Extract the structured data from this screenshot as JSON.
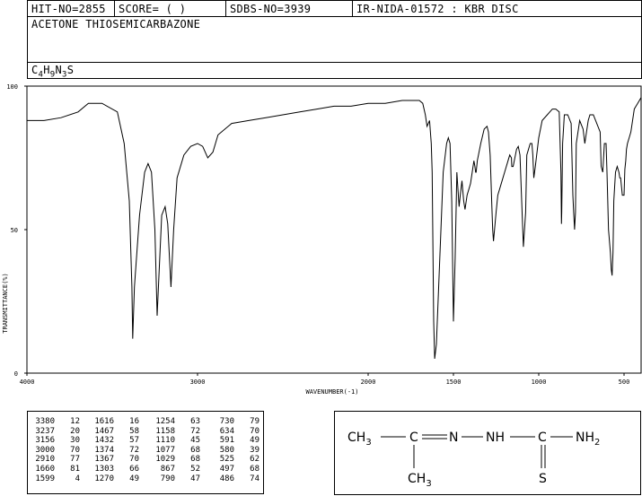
{
  "header": {
    "hit_no": "HIT-NO=2855",
    "score": "SCORE=  (   )",
    "sdbs_no": "SDBS-NO=3939",
    "ir_nida": "IR-NIDA-01572 : KBR DISC"
  },
  "compound": {
    "name": "ACETONE THIOSEMICARBAZONE",
    "formula_parts": [
      "C",
      "4",
      "H",
      "9",
      "N",
      "3",
      "S"
    ]
  },
  "chart_data": {
    "type": "line",
    "xlabel": "WAVENUMBER(-1)",
    "ylabel": "TRANSMITTANCE(%)",
    "xlim": [
      4000,
      400
    ],
    "ylim": [
      0,
      100
    ],
    "x_ticks": [
      4000,
      3000,
      2000,
      1500,
      1000,
      500
    ],
    "y_ticks": [
      0,
      50,
      100
    ],
    "grid": false,
    "series": [
      {
        "x": [
          4000,
          3960,
          3900,
          3800,
          3700,
          3640,
          3560,
          3470,
          3430,
          3400,
          3385,
          3380,
          3370,
          3340,
          3310,
          3290,
          3270,
          3250,
          3237,
          3225,
          3210,
          3190,
          3175,
          3160,
          3156,
          3140,
          3120,
          3080,
          3040,
          3000,
          2970,
          2940,
          2910,
          2880,
          2800,
          2700,
          2600,
          2500,
          2400,
          2300,
          2200,
          2100,
          2000,
          1900,
          1800,
          1700,
          1680,
          1665,
          1655,
          1640,
          1630,
          1625,
          1616,
          1610,
          1600,
          1580,
          1560,
          1540,
          1530,
          1520,
          1510,
          1500,
          1490,
          1480,
          1467,
          1460,
          1450,
          1440,
          1432,
          1420,
          1400,
          1390,
          1380,
          1374,
          1370,
          1367,
          1360,
          1340,
          1320,
          1303,
          1295,
          1285,
          1275,
          1270,
          1265,
          1250,
          1240,
          1220,
          1200,
          1180,
          1170,
          1160,
          1158,
          1150,
          1130,
          1120,
          1110,
          1100,
          1090,
          1077,
          1070,
          1050,
          1040,
          1035,
          1029,
          1020,
          1000,
          980,
          950,
          920,
          900,
          880,
          870,
          867,
          865,
          860,
          850,
          830,
          810,
          800,
          795,
          790,
          785,
          780,
          760,
          740,
          730,
          720,
          710,
          700,
          680,
          660,
          640,
          634,
          625,
          615,
          605,
          600,
          591,
          580,
          575,
          570,
          565,
          560,
          550,
          540,
          530,
          525,
          520,
          510,
          500,
          497,
          495,
          490,
          486,
          480,
          470,
          460,
          450,
          440,
          430,
          420,
          410,
          400
        ],
        "y": [
          88,
          88,
          88,
          89,
          91,
          94,
          94,
          91,
          80,
          60,
          30,
          12,
          30,
          55,
          70,
          73,
          70,
          50,
          20,
          36,
          55,
          58,
          52,
          35,
          30,
          50,
          68,
          76,
          79,
          80,
          79,
          75,
          77,
          83,
          87,
          88,
          89,
          90,
          91,
          92,
          93,
          93,
          94,
          94,
          95,
          95,
          94,
          90,
          86,
          88,
          80,
          70,
          18,
          5,
          10,
          40,
          70,
          80,
          82,
          80,
          60,
          18,
          40,
          70,
          58,
          62,
          67,
          60,
          57,
          62,
          66,
          70,
          74,
          72,
          70,
          70,
          74,
          80,
          85,
          86,
          84,
          76,
          58,
          50,
          46,
          56,
          62,
          66,
          70,
          74,
          76,
          75,
          72,
          72,
          78,
          79,
          76,
          60,
          44,
          56,
          76,
          80,
          80,
          76,
          68,
          72,
          82,
          88,
          90,
          92,
          92,
          91,
          70,
          52,
          56,
          80,
          90,
          90,
          87,
          62,
          56,
          50,
          56,
          80,
          88,
          85,
          80,
          84,
          88,
          90,
          90,
          87,
          84,
          72,
          70,
          80,
          80,
          70,
          50,
          42,
          36,
          34,
          42,
          60,
          70,
          72,
          70,
          68,
          68,
          62,
          62,
          68,
          71,
          74,
          78,
          80,
          82,
          84,
          88,
          92,
          93,
          94,
          95,
          96
        ]
      }
    ],
    "peak_table": [
      [
        [
          3380,
          12
        ],
        [
          3237,
          20
        ],
        [
          3156,
          30
        ],
        [
          3000,
          70
        ],
        [
          2910,
          77
        ],
        [
          1660,
          81
        ],
        [
          1599,
          4
        ]
      ],
      [
        [
          1616,
          16
        ],
        [
          1467,
          58
        ],
        [
          1432,
          57
        ],
        [
          1374,
          72
        ],
        [
          1367,
          70
        ],
        [
          1303,
          66
        ],
        [
          1270,
          49
        ]
      ],
      [
        [
          1254,
          63
        ],
        [
          1158,
          72
        ],
        [
          1110,
          45
        ],
        [
          1077,
          68
        ],
        [
          1029,
          68
        ],
        [
          867,
          52
        ],
        [
          790,
          47
        ]
      ],
      [
        [
          730,
          79
        ],
        [
          634,
          70
        ],
        [
          591,
          49
        ],
        [
          580,
          39
        ],
        [
          525,
          62
        ],
        [
          497,
          68
        ],
        [
          486,
          74
        ]
      ]
    ]
  },
  "structure": {
    "methyl_left": "CH",
    "methyl_left_sub": "3",
    "carbon1": "C",
    "nitrogen1": "N",
    "nh": "NH",
    "carbon2": "C",
    "amine": "NH",
    "amine_sub": "2",
    "sulfur": "S",
    "methyl_bottom": "CH",
    "methyl_bottom_sub": "3"
  }
}
